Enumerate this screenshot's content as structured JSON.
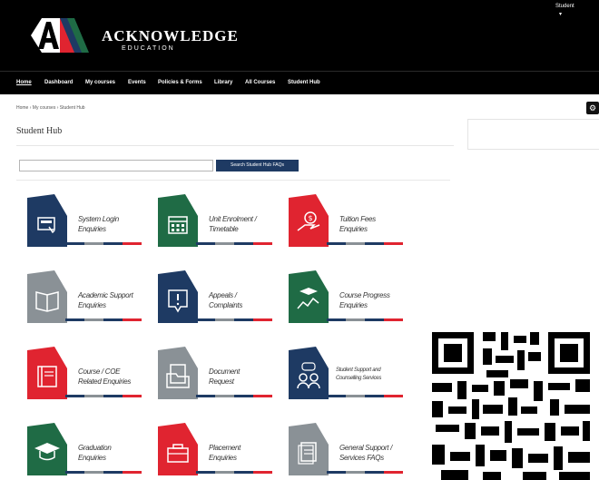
{
  "header": {
    "brand": "ACKNOWLEDGE",
    "brand_sub": "EDUCATION",
    "user_name": "Student",
    "user_caret": "▾"
  },
  "nav": {
    "items": [
      "Home",
      "Dashboard",
      "My courses",
      "Events",
      "Policies & Forms",
      "Library",
      "All Courses",
      "Student Hub"
    ]
  },
  "breadcrumb": "Home  ›  My courses  ›  Student Hub",
  "page_title": "Student Hub",
  "search": {
    "value": "",
    "placeholder": "",
    "button_label": "Search Student Hub FAQs"
  },
  "colors": {
    "navy": "#1e3a63",
    "green": "#1f6b45",
    "red": "#e02430",
    "grey": "#8a9196"
  },
  "tiles": [
    {
      "line1": "System Login",
      "line2": "Enquiries",
      "color": "#1e3a63",
      "icon": "monitor-login-icon"
    },
    {
      "line1": "Unit Enrolment /",
      "line2": "Timetable",
      "color": "#1f6b45",
      "icon": "calendar-icon"
    },
    {
      "line1": "Tuition Fees",
      "line2": "Enquiries",
      "color": "#e02430",
      "icon": "coin-hand-icon"
    },
    {
      "line1": "Academic Support",
      "line2": "Enquiries",
      "color": "#8a9196",
      "icon": "open-book-icon"
    },
    {
      "line1": "Appeals /",
      "line2": "Complaints",
      "color": "#1e3a63",
      "icon": "alert-message-icon"
    },
    {
      "line1": "Course Progress",
      "line2": "Enquiries",
      "color": "#1f6b45",
      "icon": "progress-chart-icon"
    },
    {
      "line1": "Course / COE",
      "line2": "Related Enquiries",
      "color": "#e02430",
      "icon": "course-book-icon"
    },
    {
      "line1": "Document",
      "line2": "Request",
      "color": "#8a9196",
      "icon": "document-folder-icon"
    },
    {
      "line1": "Student Support and",
      "line2": "Counselling Services",
      "color": "#1e3a63",
      "icon": "people-chat-icon"
    },
    {
      "line1": "Graduation",
      "line2": "Enquiries",
      "color": "#1f6b45",
      "icon": "graduation-cap-icon"
    },
    {
      "line1": "Placement",
      "line2": "Enquiries",
      "color": "#e02430",
      "icon": "briefcase-icon"
    },
    {
      "line1": "General Support /",
      "line2": "Services FAQs",
      "color": "#8a9196",
      "icon": "document-stack-icon"
    }
  ]
}
